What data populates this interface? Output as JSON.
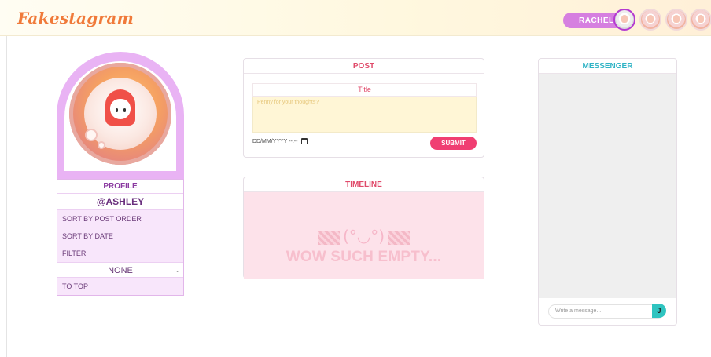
{
  "header": {
    "logo": "Fakestagram",
    "current_user": "RACHEL"
  },
  "profile": {
    "title": "PROFILE",
    "username": "@ASHLEY",
    "menu": {
      "sort_post_order": "SORT BY POST ORDER",
      "sort_date": "SORT BY DATE",
      "filter": "FILTER",
      "filter_value": "NONE",
      "to_top": "TO TOP"
    }
  },
  "post": {
    "title": "POST",
    "title_placeholder": "Title",
    "body_placeholder": "Penny for your thoughts?",
    "date_placeholder": "DD/MM/YYYY --:--",
    "submit": "SUBMIT"
  },
  "timeline": {
    "title": "TIMELINE",
    "kaomoji": "(°◡°)",
    "empty_message": "WOW SUCH EMPTY..."
  },
  "messenger": {
    "title": "MESSENGER",
    "input_placeholder": "Write a message...",
    "send_icon": "J"
  },
  "colors": {
    "logo": "#f07a3a",
    "accent_purple": "#d67fe0",
    "accent_pink": "#f03e72",
    "messenger_teal": "#2fb3c5"
  }
}
